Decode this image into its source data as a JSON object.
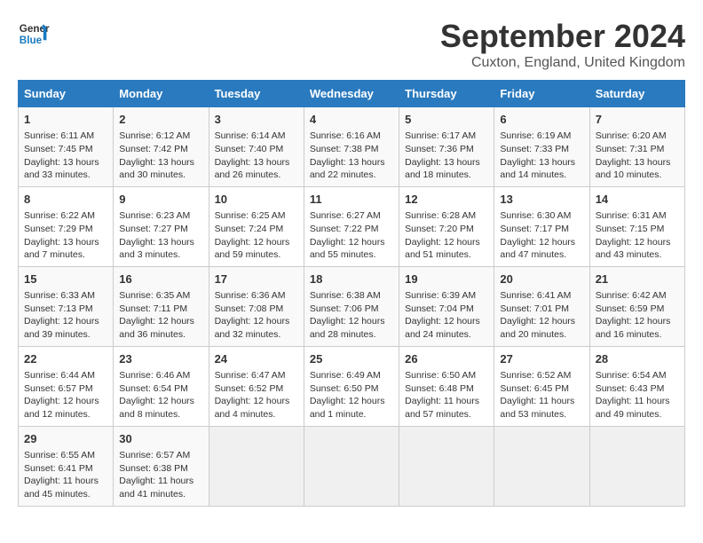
{
  "logo": {
    "line1": "General",
    "line2": "Blue"
  },
  "title": "September 2024",
  "location": "Cuxton, England, United Kingdom",
  "days_header": [
    "Sunday",
    "Monday",
    "Tuesday",
    "Wednesday",
    "Thursday",
    "Friday",
    "Saturday"
  ],
  "weeks": [
    [
      {
        "num": "1",
        "info": "Sunrise: 6:11 AM\nSunset: 7:45 PM\nDaylight: 13 hours\nand 33 minutes."
      },
      {
        "num": "2",
        "info": "Sunrise: 6:12 AM\nSunset: 7:42 PM\nDaylight: 13 hours\nand 30 minutes."
      },
      {
        "num": "3",
        "info": "Sunrise: 6:14 AM\nSunset: 7:40 PM\nDaylight: 13 hours\nand 26 minutes."
      },
      {
        "num": "4",
        "info": "Sunrise: 6:16 AM\nSunset: 7:38 PM\nDaylight: 13 hours\nand 22 minutes."
      },
      {
        "num": "5",
        "info": "Sunrise: 6:17 AM\nSunset: 7:36 PM\nDaylight: 13 hours\nand 18 minutes."
      },
      {
        "num": "6",
        "info": "Sunrise: 6:19 AM\nSunset: 7:33 PM\nDaylight: 13 hours\nand 14 minutes."
      },
      {
        "num": "7",
        "info": "Sunrise: 6:20 AM\nSunset: 7:31 PM\nDaylight: 13 hours\nand 10 minutes."
      }
    ],
    [
      {
        "num": "8",
        "info": "Sunrise: 6:22 AM\nSunset: 7:29 PM\nDaylight: 13 hours\nand 7 minutes."
      },
      {
        "num": "9",
        "info": "Sunrise: 6:23 AM\nSunset: 7:27 PM\nDaylight: 13 hours\nand 3 minutes."
      },
      {
        "num": "10",
        "info": "Sunrise: 6:25 AM\nSunset: 7:24 PM\nDaylight: 12 hours\nand 59 minutes."
      },
      {
        "num": "11",
        "info": "Sunrise: 6:27 AM\nSunset: 7:22 PM\nDaylight: 12 hours\nand 55 minutes."
      },
      {
        "num": "12",
        "info": "Sunrise: 6:28 AM\nSunset: 7:20 PM\nDaylight: 12 hours\nand 51 minutes."
      },
      {
        "num": "13",
        "info": "Sunrise: 6:30 AM\nSunset: 7:17 PM\nDaylight: 12 hours\nand 47 minutes."
      },
      {
        "num": "14",
        "info": "Sunrise: 6:31 AM\nSunset: 7:15 PM\nDaylight: 12 hours\nand 43 minutes."
      }
    ],
    [
      {
        "num": "15",
        "info": "Sunrise: 6:33 AM\nSunset: 7:13 PM\nDaylight: 12 hours\nand 39 minutes."
      },
      {
        "num": "16",
        "info": "Sunrise: 6:35 AM\nSunset: 7:11 PM\nDaylight: 12 hours\nand 36 minutes."
      },
      {
        "num": "17",
        "info": "Sunrise: 6:36 AM\nSunset: 7:08 PM\nDaylight: 12 hours\nand 32 minutes."
      },
      {
        "num": "18",
        "info": "Sunrise: 6:38 AM\nSunset: 7:06 PM\nDaylight: 12 hours\nand 28 minutes."
      },
      {
        "num": "19",
        "info": "Sunrise: 6:39 AM\nSunset: 7:04 PM\nDaylight: 12 hours\nand 24 minutes."
      },
      {
        "num": "20",
        "info": "Sunrise: 6:41 AM\nSunset: 7:01 PM\nDaylight: 12 hours\nand 20 minutes."
      },
      {
        "num": "21",
        "info": "Sunrise: 6:42 AM\nSunset: 6:59 PM\nDaylight: 12 hours\nand 16 minutes."
      }
    ],
    [
      {
        "num": "22",
        "info": "Sunrise: 6:44 AM\nSunset: 6:57 PM\nDaylight: 12 hours\nand 12 minutes."
      },
      {
        "num": "23",
        "info": "Sunrise: 6:46 AM\nSunset: 6:54 PM\nDaylight: 12 hours\nand 8 minutes."
      },
      {
        "num": "24",
        "info": "Sunrise: 6:47 AM\nSunset: 6:52 PM\nDaylight: 12 hours\nand 4 minutes."
      },
      {
        "num": "25",
        "info": "Sunrise: 6:49 AM\nSunset: 6:50 PM\nDaylight: 12 hours\nand 1 minute."
      },
      {
        "num": "26",
        "info": "Sunrise: 6:50 AM\nSunset: 6:48 PM\nDaylight: 11 hours\nand 57 minutes."
      },
      {
        "num": "27",
        "info": "Sunrise: 6:52 AM\nSunset: 6:45 PM\nDaylight: 11 hours\nand 53 minutes."
      },
      {
        "num": "28",
        "info": "Sunrise: 6:54 AM\nSunset: 6:43 PM\nDaylight: 11 hours\nand 49 minutes."
      }
    ],
    [
      {
        "num": "29",
        "info": "Sunrise: 6:55 AM\nSunset: 6:41 PM\nDaylight: 11 hours\nand 45 minutes."
      },
      {
        "num": "30",
        "info": "Sunrise: 6:57 AM\nSunset: 6:38 PM\nDaylight: 11 hours\nand 41 minutes."
      },
      {
        "num": "",
        "info": ""
      },
      {
        "num": "",
        "info": ""
      },
      {
        "num": "",
        "info": ""
      },
      {
        "num": "",
        "info": ""
      },
      {
        "num": "",
        "info": ""
      }
    ]
  ]
}
